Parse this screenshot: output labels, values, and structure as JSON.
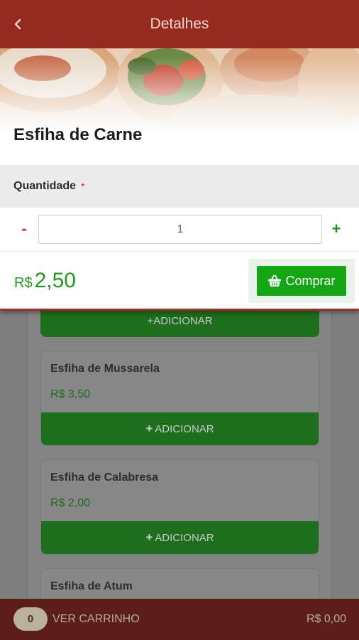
{
  "header": {
    "title": "Detalhes"
  },
  "product": {
    "name": "Esfiha de Carne",
    "price_currency": "R$",
    "price_value": "2,50"
  },
  "quantity": {
    "label": "Quantidade",
    "required_mark": "*",
    "value": "1",
    "minus": "-",
    "plus": "+"
  },
  "buy_button": {
    "label": "Comprar"
  },
  "menu": {
    "add_label": "ADICIONAR",
    "add_plus": "+",
    "items": [
      {
        "name": "Esfiha de Mussarela",
        "price": "R$ 3,50"
      },
      {
        "name": "Esfiha de Calabresa",
        "price": "R$ 2,00"
      },
      {
        "name": "Esfiha de Atum",
        "price": ""
      }
    ]
  },
  "cart": {
    "count": "0",
    "label": "VER CARRINHO",
    "total": "R$ 0,00"
  },
  "colors": {
    "header": "#952a1e",
    "accent_green": "#14a614",
    "price_green": "#1c9a1c",
    "required_red": "#d62828"
  }
}
